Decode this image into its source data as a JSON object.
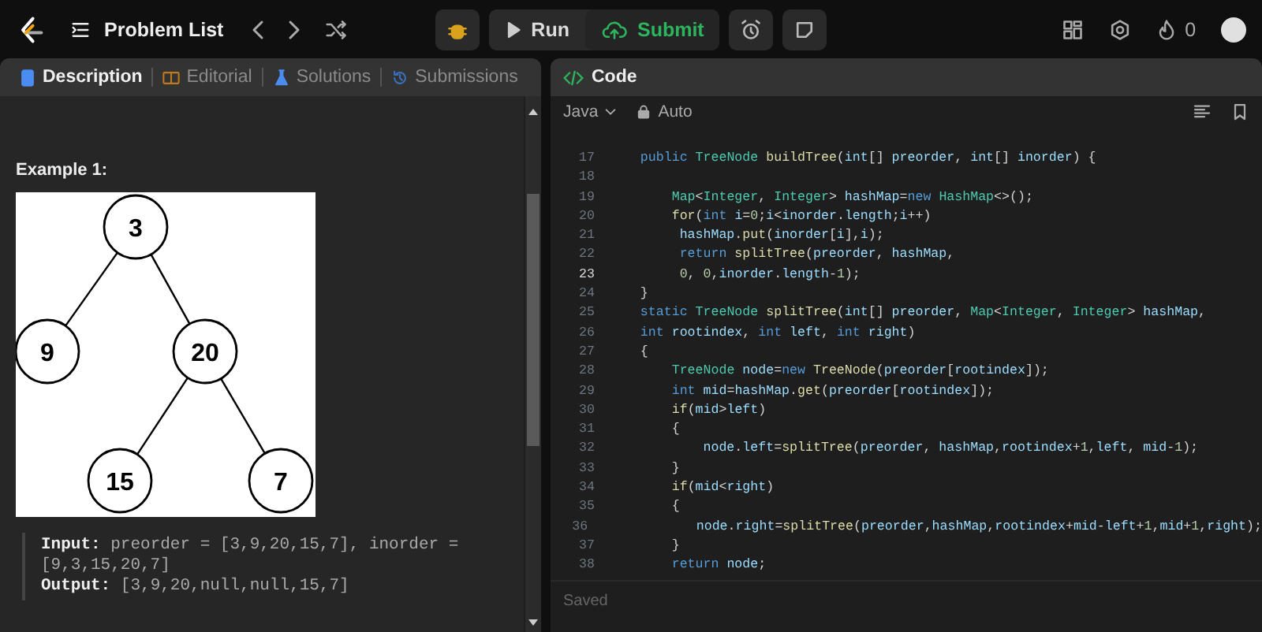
{
  "topbar": {
    "problem_list": "Problem List",
    "run": "Run",
    "submit": "Submit",
    "streak": "0"
  },
  "description": {
    "tabs": [
      {
        "label": "Description",
        "selected": true,
        "kind": "doc"
      },
      {
        "label": "Editorial",
        "selected": false,
        "kind": "book"
      },
      {
        "label": "Solutions",
        "selected": false,
        "kind": "flask"
      },
      {
        "label": "Submissions",
        "selected": false,
        "kind": "history"
      }
    ],
    "example_title": "Example 1:",
    "tree": {
      "value": "3",
      "children": [
        {
          "value": "9"
        },
        {
          "value": "20",
          "children": [
            {
              "value": "15"
            },
            {
              "value": "7"
            }
          ]
        }
      ]
    },
    "example_lines": [
      "**Input:** preorder = [3,9,20,15,7], inorder = [9,3,15,20,7]",
      "**Output:** [3,9,20,null,null,15,7]"
    ]
  },
  "editor": {
    "title": "Code",
    "language": "Java",
    "mode": "Auto",
    "status": "Saved",
    "lines": [
      {
        "num": "17",
        "current": false,
        "text": "    public TreeNode buildTree(int[] preorder, int[] inorder) {"
      },
      {
        "num": "18",
        "current": false
      },
      {
        "num": "19",
        "current": false,
        "text": "        Map<Integer, Integer> hashMap=new HashMap<>();"
      },
      {
        "num": "20",
        "current": false,
        "text": "        for(int i=0;i<inorder.length;i++)"
      },
      {
        "num": "21",
        "current": false,
        "text": "         hashMap.put(inorder[i],i);"
      },
      {
        "num": "22",
        "current": false,
        "text": "         return splitTree(preorder, hashMap,"
      },
      {
        "num": "23",
        "current": true,
        "text": "         0, 0,inorder.length-1);"
      },
      {
        "num": "24",
        "current": false,
        "text": "    }"
      },
      {
        "num": "25",
        "current": false,
        "text": "    static TreeNode splitTree(int[] preorder, Map<Integer, Integer> hashMap,"
      },
      {
        "num": "26",
        "current": false,
        "text": "    int rootindex, int left, int right)"
      },
      {
        "num": "27",
        "current": false,
        "text": "    {"
      },
      {
        "num": "28",
        "current": false,
        "text": "        TreeNode node=new TreeNode(preorder[rootindex]);"
      },
      {
        "num": "29",
        "current": false,
        "text": "        int mid=hashMap.get(preorder[rootindex]);"
      },
      {
        "num": "30",
        "current": false,
        "text": "        if(mid>left)"
      },
      {
        "num": "31",
        "current": false,
        "text": "        {"
      },
      {
        "num": "32",
        "current": false,
        "text": "            node.left=splitTree(preorder, hashMap,rootindex+1,left, mid-1);"
      },
      {
        "num": "33",
        "current": false,
        "text": "        }"
      },
      {
        "num": "34",
        "current": false,
        "text": "        if(mid<right)"
      },
      {
        "num": "35",
        "current": false,
        "text": "        {"
      },
      {
        "num": "36",
        "current": false,
        "text": "            node.right=splitTree(preorder,hashMap,rootindex+mid-left+1,mid+1,right);"
      },
      {
        "num": "37",
        "current": false,
        "text": "        }"
      },
      {
        "num": "38",
        "current": false,
        "text": "        return node;"
      }
    ]
  }
}
